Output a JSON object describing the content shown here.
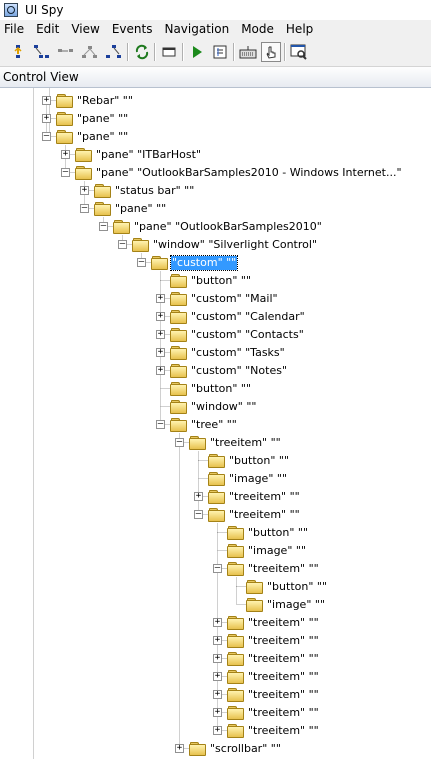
{
  "window": {
    "title": "UI Spy"
  },
  "menu": [
    "File",
    "Edit",
    "View",
    "Events",
    "Navigation",
    "Mode",
    "Help"
  ],
  "toolbar": {
    "buttons": [
      {
        "name": "navigate-parent-icon"
      },
      {
        "name": "navigate-first-child-icon"
      },
      {
        "name": "navigate-next-sibling-icon"
      },
      {
        "name": "navigate-previous-sibling-icon"
      },
      {
        "name": "navigate-last-child-icon"
      },
      {
        "name": "refresh-icon"
      },
      {
        "name": "focus-tracking-icon"
      },
      {
        "name": "play-icon"
      },
      {
        "name": "highlight-icon"
      },
      {
        "name": "keyboard-icon"
      },
      {
        "name": "hover-mode-icon"
      },
      {
        "name": "window-inspect-icon"
      }
    ]
  },
  "panel": {
    "header": "Control View"
  },
  "tree": {
    "nodes": [
      {
        "text": "\"Rebar\" \"\"",
        "level": 0,
        "exp": "+"
      },
      {
        "text": "\"pane\" \"\"",
        "level": 0,
        "exp": "+"
      },
      {
        "text": "\"pane\" \"\"",
        "level": 0,
        "exp": "-"
      },
      {
        "text": "\"pane\" \"ITBarHost\"",
        "level": 1,
        "exp": "+"
      },
      {
        "text": "\"pane\" \"OutlookBarSamples2010 - Windows Internet...\"",
        "level": 1,
        "exp": "-"
      },
      {
        "text": "\"status bar\" \"\"",
        "level": 2,
        "exp": "+"
      },
      {
        "text": "\"pane\" \"\"",
        "level": 2,
        "exp": "-"
      },
      {
        "text": "\"pane\" \"OutlookBarSamples2010\"",
        "level": 3,
        "exp": "-"
      },
      {
        "text": "\"window\" \"Silverlight Control\"",
        "level": 4,
        "exp": "-"
      },
      {
        "text": "\"custom\" \"\"",
        "level": 5,
        "exp": "-",
        "selected": true
      },
      {
        "text": "\"button\" \"\"",
        "level": 6,
        "exp": ""
      },
      {
        "text": "\"custom\" \"Mail\"",
        "level": 6,
        "exp": "+"
      },
      {
        "text": "\"custom\" \"Calendar\"",
        "level": 6,
        "exp": "+"
      },
      {
        "text": "\"custom\" \"Contacts\"",
        "level": 6,
        "exp": "+"
      },
      {
        "text": "\"custom\" \"Tasks\"",
        "level": 6,
        "exp": "+"
      },
      {
        "text": "\"custom\" \"Notes\"",
        "level": 6,
        "exp": "+"
      },
      {
        "text": "\"button\" \"\"",
        "level": 6,
        "exp": ""
      },
      {
        "text": "\"window\" \"\"",
        "level": 6,
        "exp": ""
      },
      {
        "text": "\"tree\" \"\"",
        "level": 6,
        "exp": "-"
      },
      {
        "text": "\"treeitem\" \"\"",
        "level": 7,
        "exp": "-"
      },
      {
        "text": "\"button\" \"\"",
        "level": 8,
        "exp": ""
      },
      {
        "text": "\"image\" \"\"",
        "level": 8,
        "exp": ""
      },
      {
        "text": "\"treeitem\" \"\"",
        "level": 8,
        "exp": "+"
      },
      {
        "text": "\"treeitem\" \"\"",
        "level": 8,
        "exp": "-"
      },
      {
        "text": "\"button\" \"\"",
        "level": 9,
        "exp": ""
      },
      {
        "text": "\"image\" \"\"",
        "level": 9,
        "exp": ""
      },
      {
        "text": "\"treeitem\" \"\"",
        "level": 9,
        "exp": "-"
      },
      {
        "text": "\"button\" \"\"",
        "level": 10,
        "exp": ""
      },
      {
        "text": "\"image\" \"\"",
        "level": 10,
        "exp": ""
      },
      {
        "text": "\"treeitem\" \"\"",
        "level": 9,
        "exp": "+"
      },
      {
        "text": "\"treeitem\" \"\"",
        "level": 9,
        "exp": "+"
      },
      {
        "text": "\"treeitem\" \"\"",
        "level": 9,
        "exp": "+"
      },
      {
        "text": "\"treeitem\" \"\"",
        "level": 9,
        "exp": "+"
      },
      {
        "text": "\"treeitem\" \"\"",
        "level": 9,
        "exp": "+"
      },
      {
        "text": "\"treeitem\" \"\"",
        "level": 9,
        "exp": "+"
      },
      {
        "text": "\"treeitem\" \"\"",
        "level": 9,
        "exp": "+"
      },
      {
        "text": "\"scrollbar\" \"\"",
        "level": 7,
        "exp": "+"
      }
    ]
  }
}
